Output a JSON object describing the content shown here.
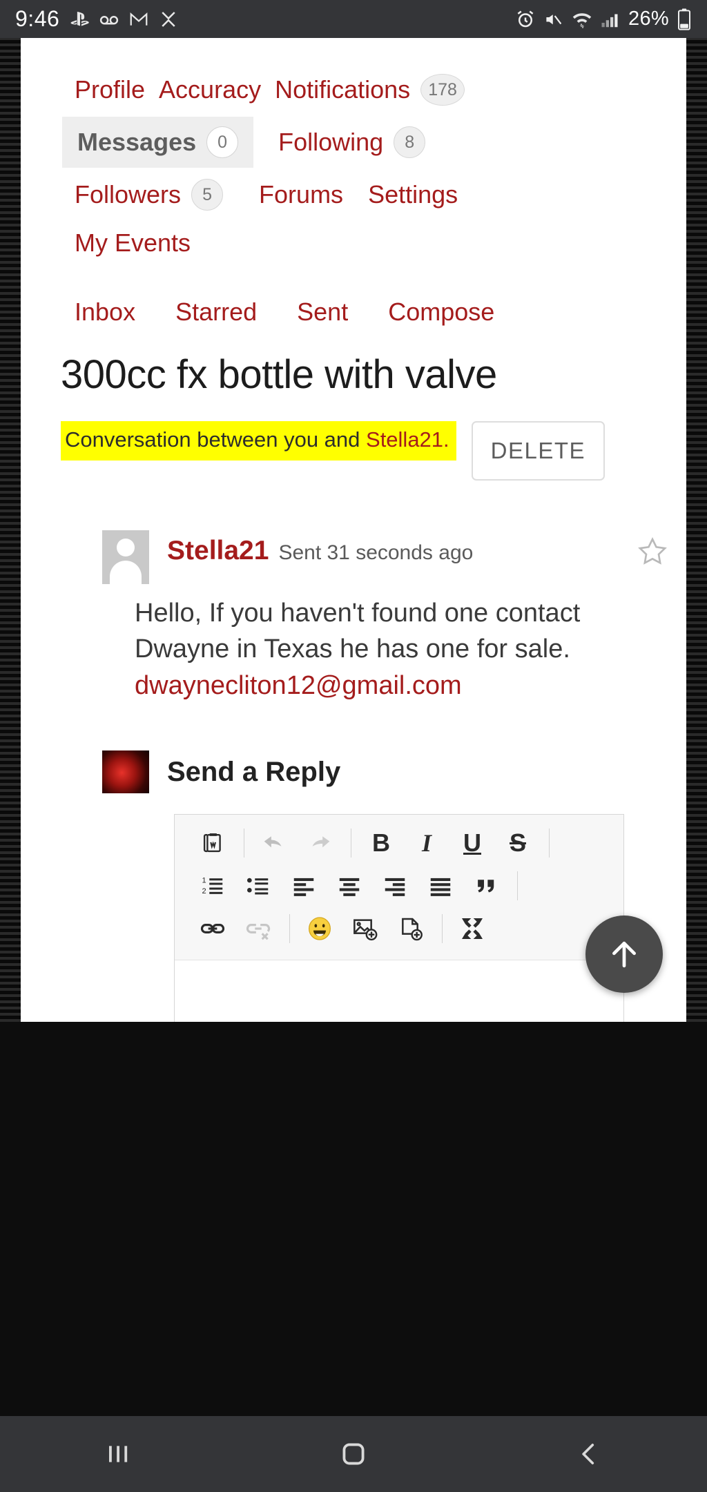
{
  "status_bar": {
    "time": "9:46",
    "battery_percent": "26%",
    "left_icons": [
      "playstation-icon",
      "voicemail-icon",
      "gmail-icon",
      "app-icon"
    ],
    "right_icons": [
      "alarm-icon",
      "mute-icon",
      "wifi-icon",
      "signal-icon",
      "battery-icon"
    ]
  },
  "nav": {
    "row1": [
      {
        "label": "Profile",
        "badge": null,
        "active": false
      },
      {
        "label": "Accuracy",
        "badge": null,
        "active": false
      },
      {
        "label": "Notifications",
        "badge": "178",
        "active": false
      }
    ],
    "row2": [
      {
        "label": "Messages",
        "badge": "0",
        "active": true
      },
      {
        "label": "Following",
        "badge": "8",
        "active": false
      }
    ],
    "row3": [
      {
        "label": "Followers",
        "badge": "5",
        "active": false
      },
      {
        "label": "Forums",
        "badge": null,
        "active": false
      },
      {
        "label": "Settings",
        "badge": null,
        "active": false
      }
    ],
    "row4": [
      {
        "label": "My Events",
        "badge": null,
        "active": false
      }
    ]
  },
  "subnav": [
    "Inbox",
    "Starred",
    "Sent",
    "Compose"
  ],
  "thread": {
    "title": "300cc fx bottle with valve",
    "conversation_prefix": "Conversation between you and ",
    "conversation_user": "Stella21.",
    "delete_label": "DELETE"
  },
  "message": {
    "author": "Stella21",
    "sent": "Sent 31 seconds ago",
    "body_line1": "Hello, If you haven't found one",
    "body_line2": "contact Dwayne in Texas he has",
    "body_line3": "one for sale.",
    "email": "dwaynecliton12@gmail.com",
    "star_icon": "star-outline-icon",
    "avatar_icon": "user-placeholder-avatar"
  },
  "reply": {
    "heading": "Send a Reply",
    "avatar_icon": "user-avatar-thumbnail",
    "toolbar_row1": [
      "paste-from-word-icon",
      "undo-icon",
      "redo-icon",
      "bold-icon",
      "italic-icon",
      "underline-icon",
      "strikethrough-icon"
    ],
    "toolbar_row2": [
      "numbered-list-icon",
      "bulleted-list-icon",
      "align-left-icon",
      "align-center-icon",
      "align-right-icon",
      "justify-icon",
      "blockquote-icon"
    ],
    "toolbar_row3": [
      "link-icon",
      "unlink-icon",
      "emoji-icon",
      "insert-image-icon",
      "insert-file-icon",
      "maximize-icon"
    ],
    "bold_label": "B",
    "italic_label": "I",
    "underline_label": "U",
    "strikethrough_label": "S",
    "editor_value": "",
    "editor_placeholder": ""
  },
  "fab": {
    "icon": "scroll-to-top-arrow-icon"
  },
  "android_navbar": [
    "recents-icon",
    "home-icon",
    "back-icon"
  ],
  "colors": {
    "link_red": "#a41c1c",
    "highlight_yellow": "#ffff00",
    "active_tab_bg": "#eeeeee",
    "status_bar_bg": "#343538"
  }
}
